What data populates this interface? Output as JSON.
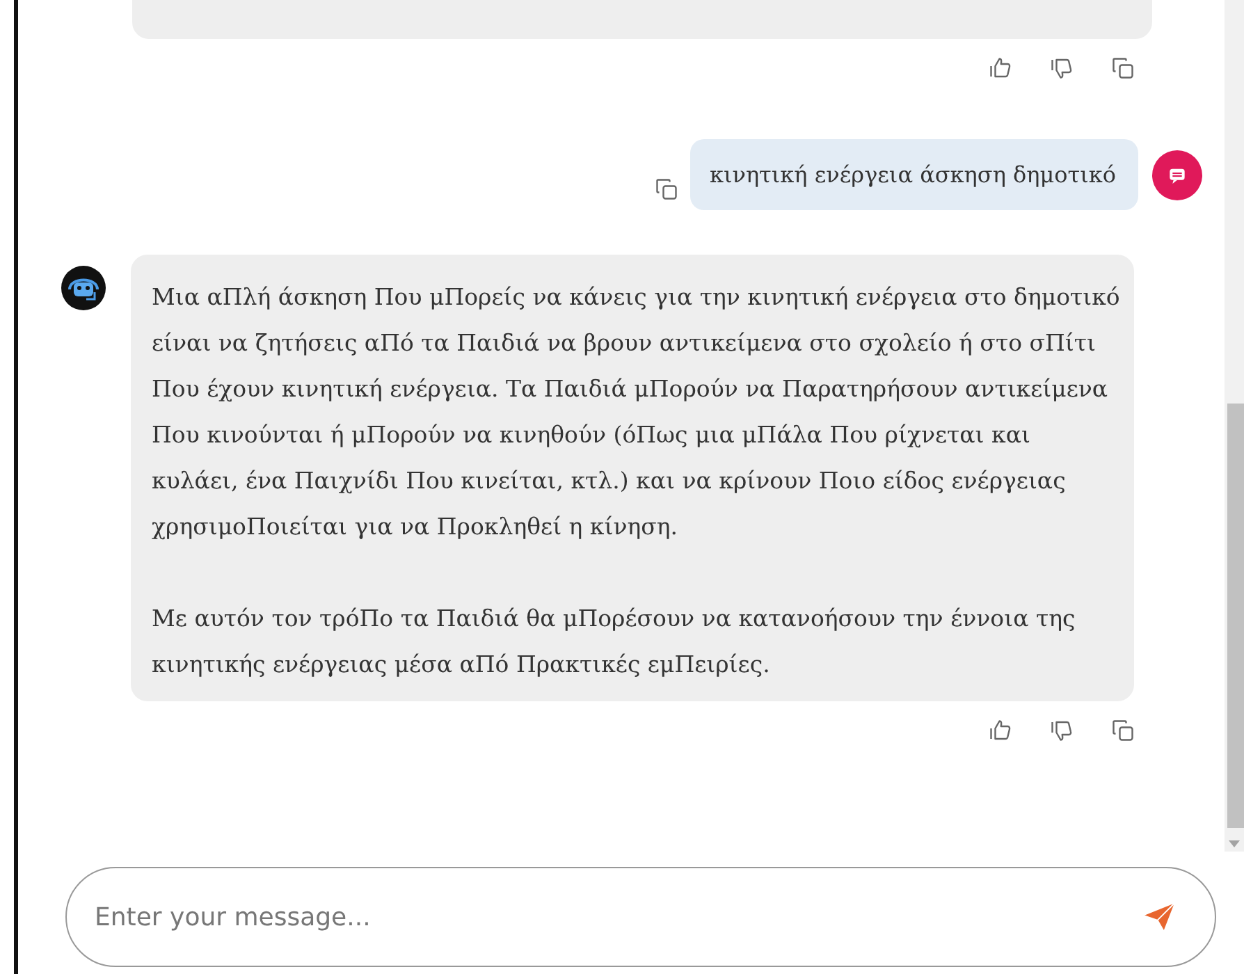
{
  "messages": [
    {
      "kind": "bot_tail",
      "actions": [
        {
          "kind": "like"
        },
        {
          "kind": "dislike"
        },
        {
          "kind": "copy"
        }
      ]
    },
    {
      "kind": "user",
      "text": "κινητική ενέργεια άσκηση δημοτικό"
    },
    {
      "kind": "bot",
      "paragraphs": [
        {
          "lines": [
            "Μια αΠλή άσκηση Που μΠορείς να κάνεις για την κινητική ενέργεια στο δημοτικό",
            "είναι να ζητήσεις αΠό τα Παιδιά να βρουν αντικείμενα στο σχολείο ή στο σΠίτι",
            "Που έχουν κινητική ενέργεια. Τα Παιδιά μΠορούν να Παρατηρήσουν αντικείμενα",
            "Που κινούνται ή μΠορούν να κινηθούν (όΠως μια μΠάλα Που ρίχνεται και",
            "κυλάει, ένα Παιχνίδι Που κινείται, κτλ.) και να κρίνουν Ποιο είδος ενέργειας",
            "χρησιμοΠοιείται για να Προκληθεί η κίνηση."
          ]
        },
        {
          "lines": [
            "Με αυτόν τον τρόΠο τα Παιδιά θα μΠορέσουν να κατανοήσουν την έννοια της",
            "κινητικής ενέργειας μέσα αΠό Πρακτικές εμΠειρίες."
          ]
        }
      ],
      "actions": [
        {
          "kind": "like"
        },
        {
          "kind": "dislike"
        },
        {
          "kind": "copy"
        }
      ]
    }
  ],
  "composer": {
    "placeholder": "Enter your message..."
  }
}
